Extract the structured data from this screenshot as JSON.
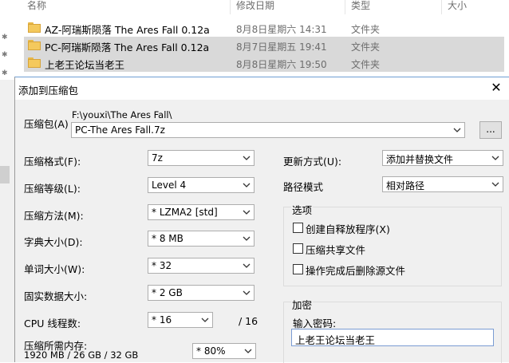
{
  "explorer": {
    "columns": {
      "name": "名称",
      "modified": "修改日期",
      "type": "类型",
      "size": "大小"
    },
    "files": [
      {
        "name": "AZ-阿瑞斯陨落  The Ares Fall  0.12a",
        "date": "8月8日星期六 14:31",
        "type": "文件夹"
      },
      {
        "name": "PC-阿瑞斯陨落  The Ares Fall  0.12a",
        "date": "8月7日星期五 19:41",
        "type": "文件夹"
      },
      {
        "name": "上老王论坛当老王",
        "date": "8月8日星期六 19:50",
        "type": "文件夹"
      }
    ]
  },
  "dialog": {
    "title": "添加到压缩包",
    "archive_label": "压缩包(A)",
    "archive_path": "F:\\youxi\\The Ares Fall\\",
    "archive_name": "PC-The Ares Fall.7z",
    "browse_label": "...",
    "left": {
      "format_label": "压缩格式(F):",
      "format_value": "7z",
      "level_label": "压缩等级(L):",
      "level_value": "Level 4",
      "method_label": "压缩方法(M):",
      "method_value": "*  LZMA2 [std]",
      "dict_label": "字典大小(D):",
      "dict_value": "*  8 MB",
      "word_label": "单词大小(W):",
      "word_value": "*  32",
      "solid_label": "固实数据大小:",
      "solid_value": "*  2 GB",
      "threads_label": "CPU 线程数:",
      "threads_value": "*  16",
      "threads_total": "/ 16",
      "memory_label": "压缩所需内存:",
      "memory_detail": "1920 MB / 26 GB / 32 GB",
      "memory_value": "* 80%"
    },
    "right": {
      "update_label": "更新方式(U):",
      "update_value": "添加并替换文件",
      "path_label": "路径模式",
      "path_value": "相对路径",
      "options_title": "选项",
      "opt_sfx": "创建自释放程序(X)",
      "opt_shared": "压缩共享文件",
      "opt_delete": "操作完成后删除源文件",
      "encrypt_title": "加密",
      "password_label": "输入密码:",
      "password_value": "上老王论坛当老王"
    }
  }
}
